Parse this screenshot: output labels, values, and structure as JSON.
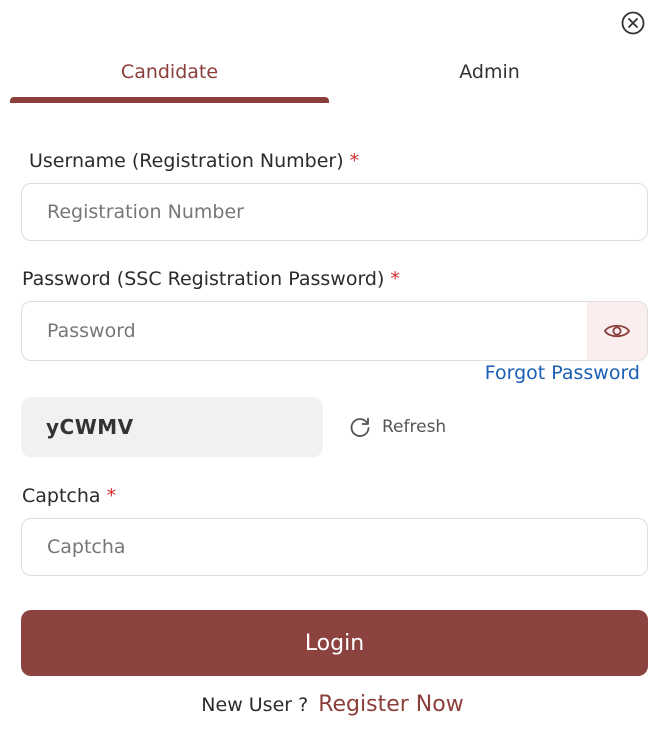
{
  "tabs": [
    {
      "label": "Candidate",
      "active": true
    },
    {
      "label": "Admin",
      "active": false
    }
  ],
  "username": {
    "label": "Username (Registration Number)",
    "required_mark": "*",
    "placeholder": "Registration Number",
    "value": ""
  },
  "password": {
    "label": "Password (SSC Registration Password)",
    "required_mark": "*",
    "placeholder": "Password",
    "value": "",
    "toggle_icon": "eye-icon"
  },
  "forgot_password": "Forgot Password",
  "captcha": {
    "code": "yCWMV",
    "refresh_label": "Refresh",
    "refresh_icon": "refresh-icon",
    "label": "Captcha",
    "required_mark": "*",
    "placeholder": "Captcha",
    "value": ""
  },
  "login_label": "Login",
  "footer": {
    "text": "New User ?",
    "link": "Register Now"
  },
  "close_icon": "close-circle-icon",
  "colors": {
    "brand": "#8c3e3b",
    "button": "#8c4340",
    "link": "#1a5fb4",
    "required": "#d32f2f"
  }
}
